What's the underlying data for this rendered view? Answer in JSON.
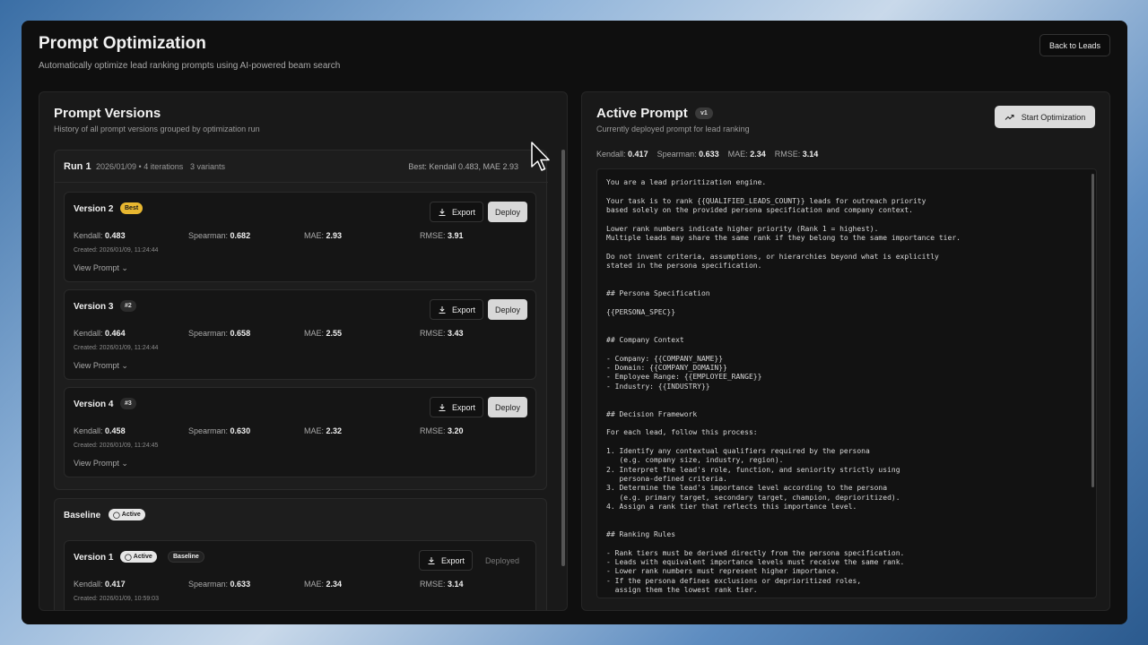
{
  "header": {
    "title": "Prompt Optimization",
    "subtitle": "Automatically optimize lead ranking prompts using AI-powered beam search",
    "back_label": "Back to Leads"
  },
  "versions_panel": {
    "title": "Prompt Versions",
    "subtitle": "History of all prompt versions grouped by optimization run",
    "run": {
      "title": "Run 1",
      "meta": "2026/01/09 • 4 iterations",
      "variants": "3 variants",
      "best": "Best: Kendall 0.483, MAE 2.93"
    },
    "cards": [
      {
        "title": "Version 2",
        "badge": "Best",
        "kendall": "0.483",
        "spearman": "0.682",
        "mae": "2.93",
        "rmse": "3.91",
        "created": "Created: 2026/01/09, 11:24:44"
      },
      {
        "title": "Version 3",
        "badge": "#2",
        "kendall": "0.464",
        "spearman": "0.658",
        "mae": "2.55",
        "rmse": "3.43",
        "created": "Created: 2026/01/09, 11:24:44"
      },
      {
        "title": "Version 4",
        "badge": "#3",
        "kendall": "0.458",
        "spearman": "0.630",
        "mae": "2.32",
        "rmse": "3.20",
        "created": "Created: 2026/01/09, 11:24:45"
      }
    ],
    "labels": {
      "kendall": "Kendall:",
      "spearman": "Spearman:",
      "mae": "MAE:",
      "rmse": "RMSE:",
      "view_prompt": "View Prompt",
      "export": "Export",
      "deploy": "Deploy",
      "deployed": "Deployed"
    },
    "baseline": {
      "title": "Baseline",
      "active_badge": "Active",
      "card": {
        "title": "Version 1",
        "badge_active": "Active",
        "badge_baseline": "Baseline",
        "kendall": "0.417",
        "spearman": "0.633",
        "mae": "2.34",
        "rmse": "3.14",
        "created": "Created: 2026/01/09, 10:59:03"
      }
    }
  },
  "active_panel": {
    "title": "Active Prompt",
    "version_badge": "v1",
    "subtitle": "Currently deployed prompt for lead ranking",
    "start_label": "Start Optimization",
    "metrics": {
      "kendall": "0.417",
      "spearman": "0.633",
      "mae": "2.34",
      "rmse": "3.14"
    },
    "prompt_text": "You are a lead prioritization engine.\n\nYour task is to rank {{QUALIFIED_LEADS_COUNT}} leads for outreach priority\nbased solely on the provided persona specification and company context.\n\nLower rank numbers indicate higher priority (Rank 1 = highest).\nMultiple leads may share the same rank if they belong to the same importance tier.\n\nDo not invent criteria, assumptions, or hierarchies beyond what is explicitly\nstated in the persona specification.\n\n\n## Persona Specification\n\n{{PERSONA_SPEC}}\n\n\n## Company Context\n\n- Company: {{COMPANY_NAME}}\n- Domain: {{COMPANY_DOMAIN}}\n- Employee Range: {{EMPLOYEE_RANGE}}\n- Industry: {{INDUSTRY}}\n\n\n## Decision Framework\n\nFor each lead, follow this process:\n\n1. Identify any contextual qualifiers required by the persona\n   (e.g. company size, industry, region).\n2. Interpret the lead's role, function, and seniority strictly using\n   persona-defined criteria.\n3. Determine the lead's importance level according to the persona\n   (e.g. primary target, secondary target, champion, deprioritized).\n4. Assign a rank tier that reflects this importance level.\n\n\n## Ranking Rules\n\n- Rank tiers must be derived directly from the persona specification.\n- Leads with equivalent importance levels must receive the same rank.\n- Lower rank numbers must represent higher importance.\n- If the persona defines exclusions or deprioritized roles,\n  assign them the lowest rank tier."
  }
}
